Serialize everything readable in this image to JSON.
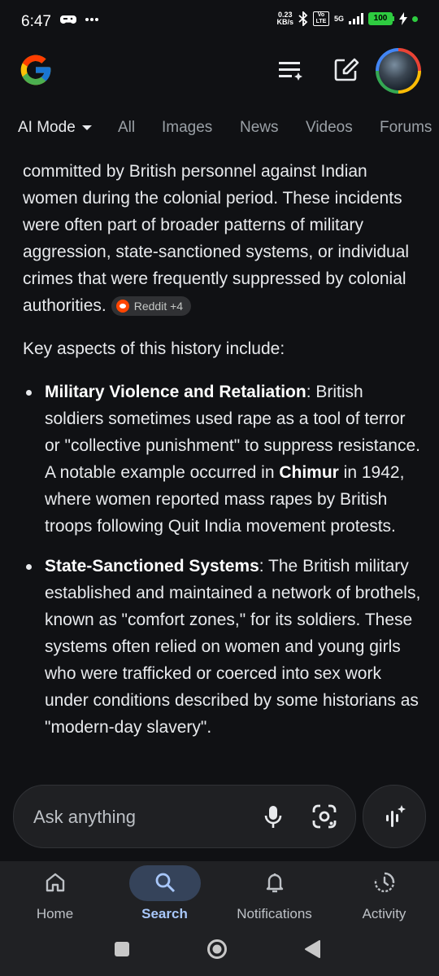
{
  "status_bar": {
    "time": "6:47",
    "speed_value": "0.23",
    "speed_unit": "KB/s",
    "volte": "Vo LTE",
    "network": "5G",
    "battery": "100"
  },
  "header": {
    "logo_icon": "google-g-logo",
    "tasks_icon": "list-sparkle-icon",
    "edit_icon": "edit-icon"
  },
  "tabs": [
    {
      "label": "AI Mode"
    },
    {
      "label": "All"
    },
    {
      "label": "Images"
    },
    {
      "label": "News"
    },
    {
      "label": "Videos"
    },
    {
      "label": "Forums"
    }
  ],
  "content": {
    "intro": "committed by British personnel against Indian women during the colonial period. These incidents were often part of broader patterns of military aggression, state-sanctioned systems, or individual crimes that were frequently suppressed by colonial authorities.",
    "source_chip": "Reddit +4",
    "key_heading": "Key aspects of this history include:",
    "bullets": [
      {
        "title": "Military Violence and Retaliation",
        "text_a": ": British soldiers sometimes used rape as a tool of terror or \"collective punishment\" to suppress resistance. A notable example occurred in ",
        "bold_place": "Chimur",
        "text_b": " in 1942, where women reported mass rapes by British troops following Quit India movement protests."
      },
      {
        "title": "State-Sanctioned Systems",
        "text_a": ": The British military established and maintained a network of brothels, known as \"comfort zones,\" for its soldiers. These systems often relied on women and young girls who were trafficked or coerced into sex work under conditions described by some historians as \"modern-day slavery\"."
      }
    ]
  },
  "input": {
    "placeholder": "Ask anything"
  },
  "bottom_nav": [
    {
      "label": "Home",
      "icon": "home-icon"
    },
    {
      "label": "Search",
      "icon": "search-icon",
      "active": true
    },
    {
      "label": "Notifications",
      "icon": "bell-icon"
    },
    {
      "label": "Activity",
      "icon": "activity-icon"
    }
  ]
}
